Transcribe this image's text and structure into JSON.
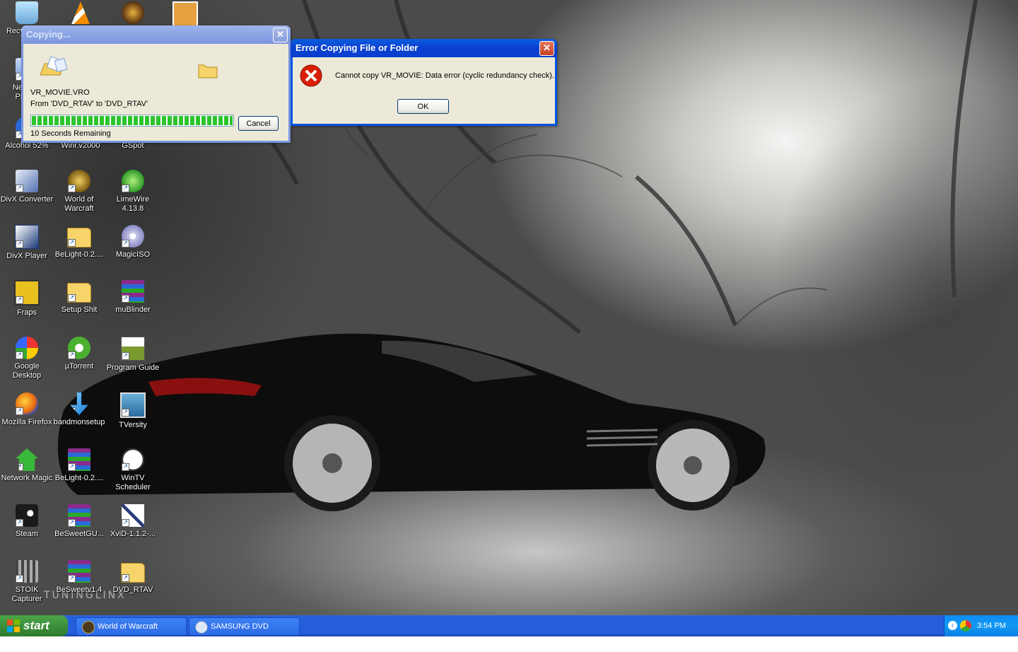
{
  "desktop": {
    "watermark": "TUNINGLINX",
    "icons": [
      {
        "label": "Recycle Bin",
        "glyph": "recycle-bin"
      },
      {
        "label": "",
        "glyph": "vlc-cone"
      },
      {
        "label": "",
        "glyph": "app-star"
      },
      {
        "label": "",
        "glyph": "archive-box"
      },
      {
        "label": "Network Places",
        "glyph": "network"
      },
      {
        "label": "Alcohol 52%",
        "glyph": "alcohol"
      },
      {
        "label": "Winr.v2000",
        "glyph": "app"
      },
      {
        "label": "GSpot",
        "glyph": "app"
      },
      {
        "label": "DivX Converter",
        "glyph": "divx"
      },
      {
        "label": "World of Warcraft",
        "glyph": "wow"
      },
      {
        "label": "LimeWire 4.13.8",
        "glyph": "limewire"
      },
      {
        "label": "DivX Player",
        "glyph": "divx-player"
      },
      {
        "label": "BeLight-0.2....",
        "glyph": "folder"
      },
      {
        "label": "MagicISO",
        "glyph": "disc"
      },
      {
        "label": "Fraps",
        "glyph": "fraps"
      },
      {
        "label": "Setup Shit",
        "glyph": "folder"
      },
      {
        "label": "muBlinder",
        "glyph": "winrar"
      },
      {
        "label": "Google Desktop",
        "glyph": "google-desktop"
      },
      {
        "label": "µTorrent",
        "glyph": "utorrent"
      },
      {
        "label": "Program Guide",
        "glyph": "titan"
      },
      {
        "label": "Mozilla Firefox",
        "glyph": "firefox"
      },
      {
        "label": "bandmonsetup",
        "glyph": "installer"
      },
      {
        "label": "TVersity",
        "glyph": "tversity"
      },
      {
        "label": "Network Magic",
        "glyph": "home"
      },
      {
        "label": "BeLight-0.2....",
        "glyph": "winrar"
      },
      {
        "label": "WinTV Scheduler",
        "glyph": "clock"
      },
      {
        "label": "Steam",
        "glyph": "steam"
      },
      {
        "label": "BeSweetGU...",
        "glyph": "winrar"
      },
      {
        "label": "XviD-1.1.2-...",
        "glyph": "xvid"
      },
      {
        "label": "STOIK Capturer",
        "glyph": "stoik"
      },
      {
        "label": "BeSweetv1.4",
        "glyph": "winrar"
      },
      {
        "label": "DVD_RTAV",
        "glyph": "folder"
      }
    ]
  },
  "copy_dialog": {
    "title": "Copying...",
    "filename": "VR_MOVIE.VRO",
    "from_to": "From 'DVD_RTAV' to 'DVD_RTAV'",
    "progress": 1.0,
    "remaining": "10 Seconds Remaining",
    "cancel_label": "Cancel",
    "close_glyph": "✕"
  },
  "error_dialog": {
    "title": "Error Copying File or Folder",
    "message": "Cannot copy VR_MOVIE: Data error (cyclic redundancy check).",
    "ok_label": "OK",
    "close_glyph": "✕",
    "icon": "error-icon"
  },
  "taskbar": {
    "start_label": "start",
    "tasks": [
      {
        "label": "World of Warcraft",
        "icon": "wow-icon"
      },
      {
        "label": "SAMSUNG DVD RECO...",
        "icon": "dvd-icon"
      }
    ],
    "clock": "3:54 PM"
  },
  "colors": {
    "xp_blue": "#0054e3",
    "error_red": "#d81e05",
    "start_green": "#3c8f3a"
  }
}
